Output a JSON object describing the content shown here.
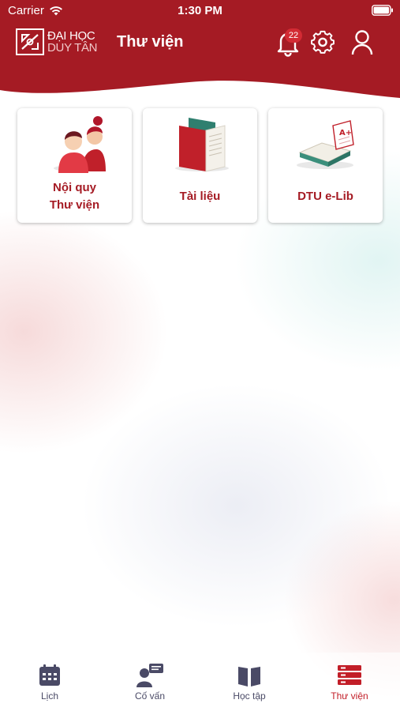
{
  "status_bar": {
    "carrier": "Carrier",
    "time": "1:30 PM"
  },
  "header": {
    "logo_line1": "ĐẠI HỌC",
    "logo_line2": "DUY TÂN",
    "title": "Thư viện",
    "notification_count": "22"
  },
  "tiles": [
    {
      "line1": "Nội quy",
      "line2": "Thư viện"
    },
    {
      "line1": "Tài liệu"
    },
    {
      "line1": "DTU e-Lib"
    }
  ],
  "tabbar": {
    "items": [
      {
        "label": "Lịch",
        "icon": "calendar-icon"
      },
      {
        "label": "Cố vấn",
        "icon": "advisor-icon"
      },
      {
        "label": "Học tập",
        "icon": "book-icon"
      },
      {
        "label": "Thư viện",
        "icon": "library-icon"
      }
    ],
    "active": "Thư viện"
  },
  "colors": {
    "brand": "#a51b24",
    "active_tab": "#c21e28",
    "inactive_tab": "#4a4a66"
  }
}
